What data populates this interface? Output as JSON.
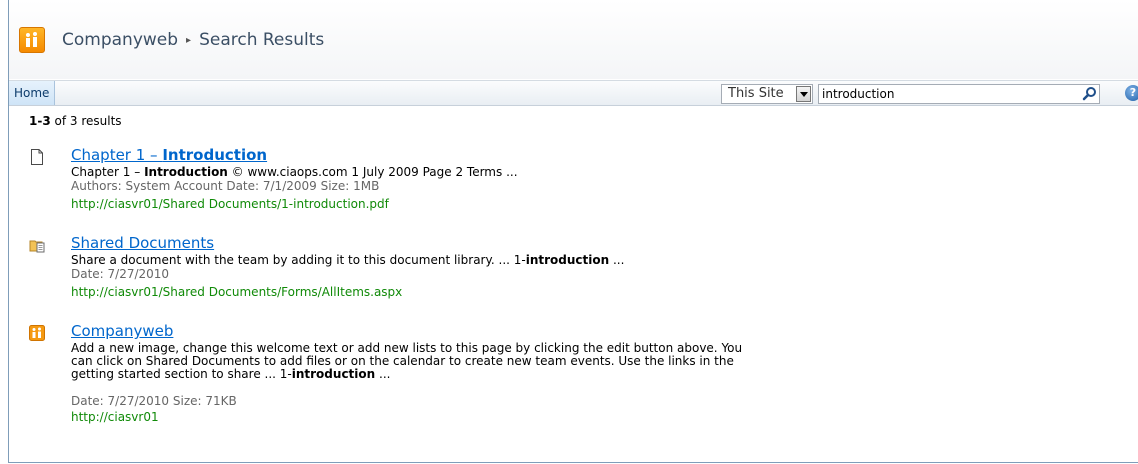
{
  "header": {
    "site": "Companyweb",
    "separator": "▸",
    "page": "Search Results"
  },
  "nav": {
    "home_tab": "Home",
    "scope": "This Site",
    "search_value": "introduction",
    "help": "?"
  },
  "summary": {
    "range": "1-3",
    "rest": " of 3 results"
  },
  "results": [
    {
      "title_pre": "Chapter 1 – ",
      "title_hit": "Introduction",
      "icon": "document-icon",
      "desc": [
        {
          "t": "Chapter 1 – ",
          "b": false
        },
        {
          "t": "Introduction",
          "b": true
        },
        {
          "t": " © www.ciaops.com 1 July 2009 Page 2 Terms ...",
          "b": false
        }
      ],
      "meta": "Authors: System Account   Date: 7/1/2009   Size: 1MB",
      "url": "http://ciasvr01/Shared Documents/1-introduction.pdf"
    },
    {
      "title": "Shared Documents",
      "icon": "document-library-icon",
      "desc": [
        {
          "t": "Share a document with the team by adding it to this document library. ... 1-",
          "b": false
        },
        {
          "t": "introduction",
          "b": true
        },
        {
          "t": " ...",
          "b": false
        }
      ],
      "meta": "Date: 7/27/2010",
      "url": "http://ciasvr01/Shared Documents/Forms/AllItems.aspx"
    },
    {
      "title": "Companyweb",
      "icon": "site-icon",
      "desc": [
        {
          "t": "Add a new image, change this welcome text or add new lists to this page by clicking the edit button above. You can click on Shared Documents to add files or on the calendar to create new team events. Use the links in the getting started section to share ... 1-",
          "b": false
        },
        {
          "t": "introduction",
          "b": true
        },
        {
          "t": " ...",
          "b": false
        }
      ],
      "meta": "Date: 7/27/2010   Size: 71KB",
      "url": "http://ciasvr01"
    }
  ],
  "colors": {
    "link": "#0066cc",
    "url": "#108a08",
    "meta": "#666666",
    "logo": "#f58a00"
  }
}
